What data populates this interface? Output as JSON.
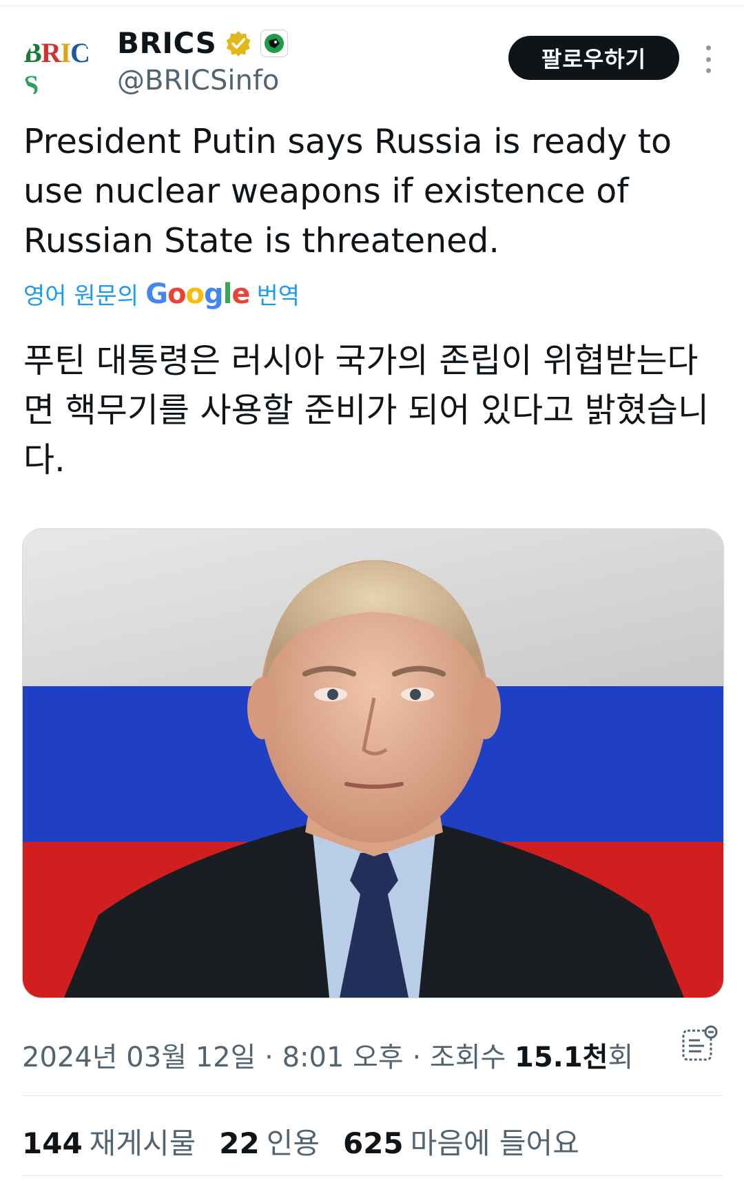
{
  "account": {
    "name": "BRICS",
    "handle": "@BRICSinfo",
    "avatar_text": "BRICS"
  },
  "actions": {
    "follow_label": "팔로우하기"
  },
  "tweet": {
    "text": "President Putin says Russia is ready to use nuclear weapons if existence of Russian State is threatened.",
    "translate_prefix": "영어 원문의",
    "translate_brand": "Google",
    "translate_suffix": "번역",
    "translated_text": "푸틴 대통령은 러시아 국가의 존립이 위협받는다면 핵무기를 사용할 준비가 되어 있다고 밝혔습니다."
  },
  "meta": {
    "date": "2024년 03월 12일",
    "time": "8:01 오후",
    "views_label": "조회수",
    "views_value": "15.1천",
    "views_suffix": "회",
    "dot": "·"
  },
  "stats": {
    "reposts_value": "144",
    "reposts_label": "재게시물",
    "quotes_value": "22",
    "quotes_label": "인용",
    "likes_value": "625",
    "likes_label": "마음에 들어요"
  },
  "colors": {
    "verified_badge": "#e2b719",
    "link": "#1d9bf0",
    "flag_white": "#d9d9d9",
    "flag_blue": "#1f3fc4",
    "flag_red": "#d11f1f"
  },
  "icons": [
    "verified-badge-icon",
    "affiliate-icon",
    "more-options-icon",
    "analytics-icon"
  ]
}
